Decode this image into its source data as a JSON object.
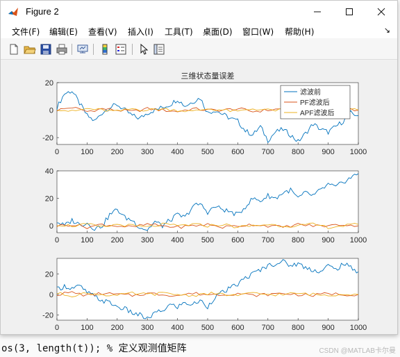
{
  "window": {
    "title": "Figure 2"
  },
  "menubar": {
    "items": [
      "文件(F)",
      "编辑(E)",
      "查看(V)",
      "插入(I)",
      "工具(T)",
      "桌面(D)",
      "窗口(W)",
      "帮助(H)"
    ]
  },
  "toolbar": {
    "icons": [
      "new-figure-icon",
      "open-icon",
      "save-icon",
      "print-icon",
      "link-icon",
      "colorbar-icon",
      "legend-icon",
      "pointer-icon",
      "property-editor-icon"
    ]
  },
  "background_editor": {
    "footer_text": "os(3, length(t)); % 定义观测值矩阵",
    "watermark": "CSDN @MATLAB卡尔曼"
  },
  "colors": {
    "series1": "#0072bd",
    "series2": "#d95319",
    "series3": "#edb120"
  },
  "chart_data": [
    {
      "type": "line",
      "title": "三维状态量误差",
      "xlim": [
        0,
        1000
      ],
      "ylim": [
        -25,
        20
      ],
      "x_ticks": [
        0,
        100,
        200,
        300,
        400,
        500,
        600,
        700,
        800,
        900,
        1000
      ],
      "y_ticks": [
        -20,
        0,
        20
      ],
      "legend": {
        "placement": "top-right",
        "entries": [
          "滤波前",
          "PF滤波后",
          "APF滤波后"
        ]
      },
      "series": [
        {
          "name": "滤波前",
          "x": [
            0,
            25,
            50,
            75,
            100,
            125,
            150,
            175,
            200,
            225,
            250,
            275,
            300,
            325,
            350,
            375,
            400,
            425,
            450,
            475,
            500,
            525,
            550,
            575,
            600,
            625,
            650,
            675,
            700,
            725,
            750,
            775,
            800,
            825,
            850,
            875,
            900,
            925,
            950,
            975,
            1000
          ],
          "values": [
            2,
            12,
            14,
            5,
            -4,
            -8,
            -2,
            2,
            4,
            0,
            -4,
            -6,
            -2,
            0,
            2,
            4,
            8,
            3,
            6,
            9,
            -2,
            0,
            -3,
            -6,
            -8,
            -15,
            -18,
            -12,
            -22,
            -16,
            -14,
            -18,
            -23,
            -17,
            -10,
            -14,
            -16,
            -12,
            -8,
            -2,
            -4
          ]
        },
        {
          "name": "PF滤波后",
          "x": [
            0,
            50,
            100,
            150,
            200,
            250,
            300,
            350,
            400,
            450,
            500,
            550,
            600,
            650,
            700,
            750,
            800,
            850,
            900,
            950,
            1000
          ],
          "values": [
            0,
            2,
            -1,
            1,
            0,
            -1,
            1,
            0,
            -1,
            1,
            0,
            0,
            1,
            -1,
            0,
            1,
            0,
            -1,
            1,
            0,
            0
          ]
        },
        {
          "name": "APF滤波后",
          "x": [
            0,
            50,
            100,
            150,
            200,
            250,
            300,
            350,
            400,
            450,
            500,
            550,
            600,
            650,
            700,
            750,
            800,
            850,
            900,
            950,
            1000
          ],
          "values": [
            1,
            -1,
            1,
            0,
            -1,
            1,
            0,
            1,
            0,
            -1,
            1,
            0,
            -1,
            1,
            0,
            0,
            1,
            0,
            -1,
            1,
            0
          ]
        }
      ]
    },
    {
      "type": "line",
      "xlim": [
        0,
        1000
      ],
      "ylim": [
        -5,
        40
      ],
      "x_ticks": [
        0,
        100,
        200,
        300,
        400,
        500,
        600,
        700,
        800,
        900,
        1000
      ],
      "y_ticks": [
        0,
        20,
        40
      ],
      "series": [
        {
          "x": [
            0,
            25,
            50,
            75,
            100,
            125,
            150,
            175,
            200,
            225,
            250,
            275,
            300,
            325,
            350,
            375,
            400,
            425,
            450,
            475,
            500,
            525,
            550,
            575,
            600,
            625,
            650,
            675,
            700,
            725,
            750,
            775,
            800,
            825,
            850,
            875,
            900,
            925,
            950,
            975,
            1000
          ],
          "values": [
            3,
            0,
            4,
            1,
            2,
            -2,
            0,
            8,
            12,
            6,
            4,
            -1,
            -3,
            3,
            0,
            4,
            8,
            6,
            14,
            16,
            10,
            14,
            12,
            10,
            8,
            14,
            20,
            18,
            22,
            20,
            24,
            26,
            20,
            24,
            22,
            26,
            30,
            28,
            32,
            35,
            38
          ]
        },
        {
          "x": [
            0,
            50,
            100,
            150,
            200,
            250,
            300,
            350,
            400,
            450,
            500,
            550,
            600,
            650,
            700,
            750,
            800,
            850,
            900,
            950,
            1000
          ],
          "values": [
            0,
            1,
            -1,
            1,
            0,
            -1,
            1,
            0,
            -1,
            0,
            1,
            -1,
            0,
            1,
            0,
            -1,
            1,
            0,
            0,
            1,
            0
          ]
        },
        {
          "x": [
            0,
            50,
            100,
            150,
            200,
            250,
            300,
            350,
            400,
            450,
            500,
            550,
            600,
            650,
            700,
            750,
            800,
            850,
            900,
            950,
            1000
          ],
          "values": [
            1,
            0,
            1,
            -1,
            1,
            0,
            -1,
            1,
            0,
            1,
            0,
            1,
            -1,
            0,
            1,
            0,
            0,
            1,
            -1,
            0,
            1
          ]
        }
      ]
    },
    {
      "type": "line",
      "xlim": [
        0,
        1000
      ],
      "ylim": [
        -25,
        35
      ],
      "x_ticks": [
        0,
        100,
        200,
        300,
        400,
        500,
        600,
        700,
        800,
        900,
        1000
      ],
      "y_ticks": [
        -20,
        0,
        20
      ],
      "series": [
        {
          "x": [
            0,
            25,
            50,
            75,
            100,
            125,
            150,
            175,
            200,
            225,
            250,
            275,
            300,
            325,
            350,
            375,
            400,
            425,
            450,
            475,
            500,
            525,
            550,
            575,
            600,
            625,
            650,
            675,
            700,
            725,
            750,
            775,
            800,
            825,
            850,
            875,
            900,
            925,
            950,
            975,
            1000
          ],
          "values": [
            5,
            8,
            6,
            8,
            2,
            -2,
            -6,
            -8,
            -12,
            -14,
            -18,
            -20,
            -24,
            -18,
            -16,
            -10,
            -12,
            -8,
            -10,
            -6,
            -12,
            -2,
            2,
            6,
            10,
            16,
            20,
            24,
            28,
            30,
            32,
            28,
            30,
            26,
            24,
            22,
            28,
            24,
            30,
            26,
            22
          ]
        },
        {
          "x": [
            0,
            50,
            100,
            150,
            200,
            250,
            300,
            350,
            400,
            450,
            500,
            550,
            600,
            650,
            700,
            750,
            800,
            850,
            900,
            950,
            1000
          ],
          "values": [
            0,
            2,
            -1,
            1,
            0,
            -1,
            1,
            0,
            -1,
            1,
            0,
            0,
            1,
            -1,
            0,
            1,
            0,
            -1,
            1,
            0,
            0
          ]
        },
        {
          "x": [
            0,
            50,
            100,
            150,
            200,
            250,
            300,
            350,
            400,
            450,
            500,
            550,
            600,
            650,
            700,
            750,
            800,
            850,
            900,
            950,
            1000
          ],
          "values": [
            1,
            -1,
            1,
            0,
            -1,
            1,
            0,
            1,
            0,
            -1,
            1,
            0,
            -1,
            1,
            0,
            0,
            1,
            0,
            -1,
            1,
            0
          ]
        }
      ]
    }
  ]
}
